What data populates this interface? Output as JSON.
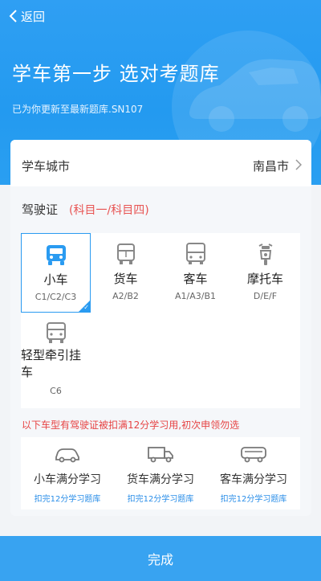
{
  "header": {
    "back_label": "返回",
    "title": "学车第一步 选对考题库",
    "subtitle": "已为你更新至最新题库.SN107"
  },
  "city": {
    "label": "学车城市",
    "value": "南昌市"
  },
  "license": {
    "label": "驾驶证",
    "note": "(科目一/科目四)",
    "types": [
      {
        "name": "小车",
        "codes": "C1/C2/C3",
        "icon": "car-icon",
        "selected": true
      },
      {
        "name": "货车",
        "codes": "A2/B2",
        "icon": "truck-icon",
        "selected": false
      },
      {
        "name": "客车",
        "codes": "A1/A3/B1",
        "icon": "bus-icon",
        "selected": false
      },
      {
        "name": "摩托车",
        "codes": "D/E/F",
        "icon": "motorcycle-icon",
        "selected": false
      },
      {
        "name": "轻型牵引挂车",
        "codes": "C6",
        "icon": "tow-trailer-icon",
        "selected": false
      }
    ]
  },
  "warning": "以下车型有驾驶证被扣满12分学习用,初次申领勿选",
  "study": [
    {
      "name": "小车满分学习",
      "link": "扣完12分学习题库",
      "icon": "car-outline-icon"
    },
    {
      "name": "货车满分学习",
      "link": "扣完12分学习题库",
      "icon": "truck-outline-icon"
    },
    {
      "name": "客车满分学习",
      "link": "扣完12分学习题库",
      "icon": "bus-outline-icon"
    }
  ],
  "footer": {
    "done_label": "完成"
  },
  "colors": {
    "primary": "#2a9bf1",
    "accent_red": "#e85453",
    "background": "#f2f4f7"
  }
}
